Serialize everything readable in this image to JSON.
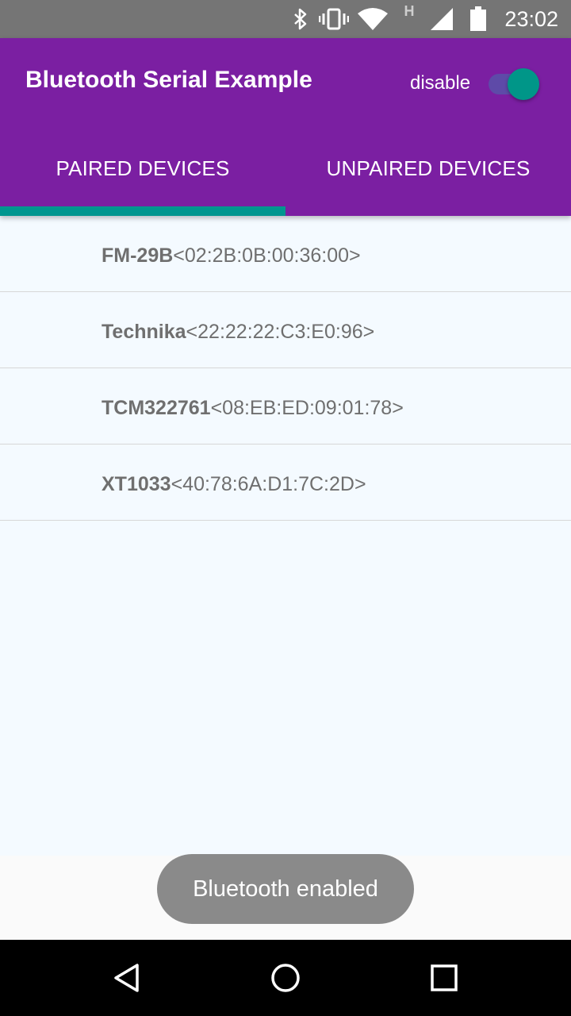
{
  "status_bar": {
    "time": "23:02",
    "icons": [
      "bluetooth-icon",
      "vibrate-icon",
      "wifi-icon",
      "network-type-H",
      "cell-signal-icon",
      "battery-icon"
    ],
    "network_type": "H"
  },
  "app_bar": {
    "title": "Bluetooth Serial Example",
    "toggle_label": "disable",
    "toggle_on": true
  },
  "tabs": [
    {
      "label": "PAIRED DEVICES",
      "selected": true
    },
    {
      "label": "UNPAIRED DEVICES",
      "selected": false
    }
  ],
  "devices": [
    {
      "name": "FM-29B",
      "address": "<02:2B:0B:00:36:00>"
    },
    {
      "name": "Technika",
      "address": "<22:22:22:C3:E0:96>"
    },
    {
      "name": "TCM322761",
      "address": "<08:EB:ED:09:01:78>"
    },
    {
      "name": "XT1033",
      "address": "<40:78:6A:D1:7C:2D>"
    }
  ],
  "toast": {
    "message": "Bluetooth enabled"
  },
  "nav_bar": {
    "buttons": [
      "back-icon",
      "home-icon",
      "recents-icon"
    ]
  },
  "colors": {
    "primary": "#7b1fa2",
    "accent": "#009688",
    "status_bar": "#757575",
    "list_background": "#f4faff"
  }
}
